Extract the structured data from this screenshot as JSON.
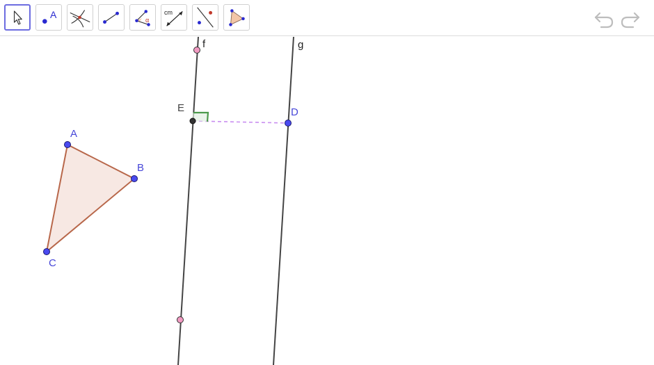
{
  "toolbar": {
    "tools": [
      {
        "name": "move",
        "icon": "pointer-arrow-icon",
        "active": true
      },
      {
        "name": "point",
        "icon": "point-icon",
        "label": "A"
      },
      {
        "name": "intersect",
        "icon": "intersect-icon"
      },
      {
        "name": "segment",
        "icon": "segment-icon"
      },
      {
        "name": "angle",
        "icon": "angle-icon",
        "label": "α"
      },
      {
        "name": "distance",
        "icon": "distance-icon",
        "label": "cm"
      },
      {
        "name": "reflect",
        "icon": "reflect-line-icon"
      },
      {
        "name": "polygon",
        "icon": "polygon-icon"
      }
    ],
    "undo_icon": "undo-icon",
    "redo_icon": "redo-icon"
  },
  "construction": {
    "points": {
      "A": "A",
      "B": "B",
      "C": "C",
      "D": "D",
      "E": "E"
    },
    "lines": {
      "f": "f",
      "g": "g"
    },
    "colors": {
      "point_blue": "#4a4af0",
      "point_pink": "#f29ac2",
      "point_black": "#333333",
      "line": "#444444",
      "polygon_edge": "#b8674a",
      "polygon_fill": "#f6e7e2",
      "right_angle": "#4c9a4c",
      "dashed": "#c98ef0"
    }
  }
}
